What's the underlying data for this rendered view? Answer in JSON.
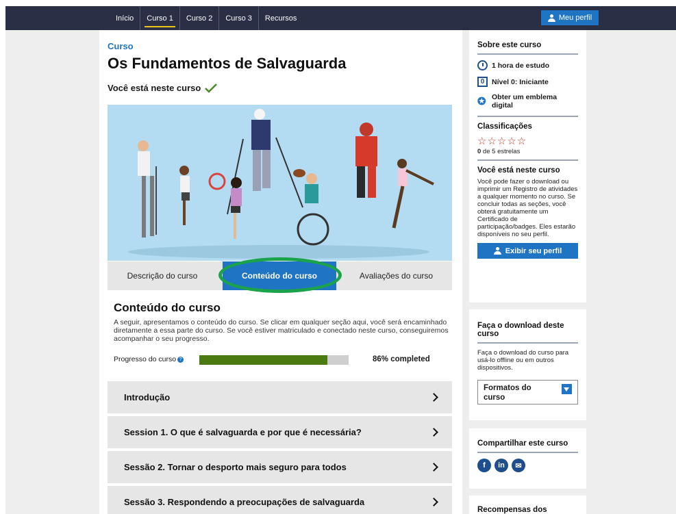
{
  "nav": {
    "items": [
      {
        "label": "Início",
        "active": false
      },
      {
        "label": "Curso 1",
        "active": true
      },
      {
        "label": "Curso 2",
        "active": false
      },
      {
        "label": "Curso 3",
        "active": false
      },
      {
        "label": "Recursos",
        "active": false
      }
    ],
    "profile_label": "Meu perfil"
  },
  "course": {
    "kicker": "Curso",
    "title": "Os Fundamentos de Salvaguarda",
    "enrolled": "Você está neste curso"
  },
  "tabs": {
    "description": "Descrição do curso",
    "content": "Conteúdo do curso",
    "reviews": "Avaliações do curso"
  },
  "content": {
    "heading": "Conteúdo do curso",
    "description": "A seguir, apresentamos o conteúdo do curso. Se clicar em qualquer seção aqui, você será encaminhado diretamente a essa parte do curso. Se você estiver matriculado e conectado neste curso, conseguiremos acompanhar o seu progresso.",
    "progress_label": "Progresso do curso",
    "progress_value": 0.86,
    "progress_text": "86% completed"
  },
  "sessions": [
    "Introdução",
    "Session 1. O que é salvaguarda e por que é necessária?",
    "Sessão 2. Tornar o desporto mais seguro para todos",
    "Sessão 3. Respondendo a preocupações de salvaguarda"
  ],
  "sidebar": {
    "about_title": "Sobre este curso",
    "hours": "1 hora de estudo",
    "level_number": "0",
    "level": "Nível 0: Iniciante",
    "badge": "Obter um emblema digital",
    "ratings_title": "Classificações",
    "stars_glyphs": "☆☆☆☆☆",
    "rating_value": "0",
    "rating_suffix": " de 5 estrelas",
    "enrolled_title": "Você está neste curso",
    "enrolled_text": "Você pode fazer o download ou imprimir um Registro de atividades a qualquer momento no curso. Se concluir todas as seções, você obterá gratuitamente um Certificado de participação/badges. Eles estarão disponíveis no seu perfil.",
    "view_profile": "Exibir seu perfil",
    "download_title": "Faça o download deste curso",
    "download_text": "Faça o download do curso para usá-lo offline ou em outros dispositivos.",
    "formats": "Formatos do curso",
    "share_title": "Compartilhar este curso",
    "next_title": "Recompensas dos"
  },
  "colors": {
    "nav_bg": "#2a2f45",
    "accent": "#1f74c4",
    "progress": "#4a7a10",
    "highlight_ring": "#1aa34a"
  }
}
